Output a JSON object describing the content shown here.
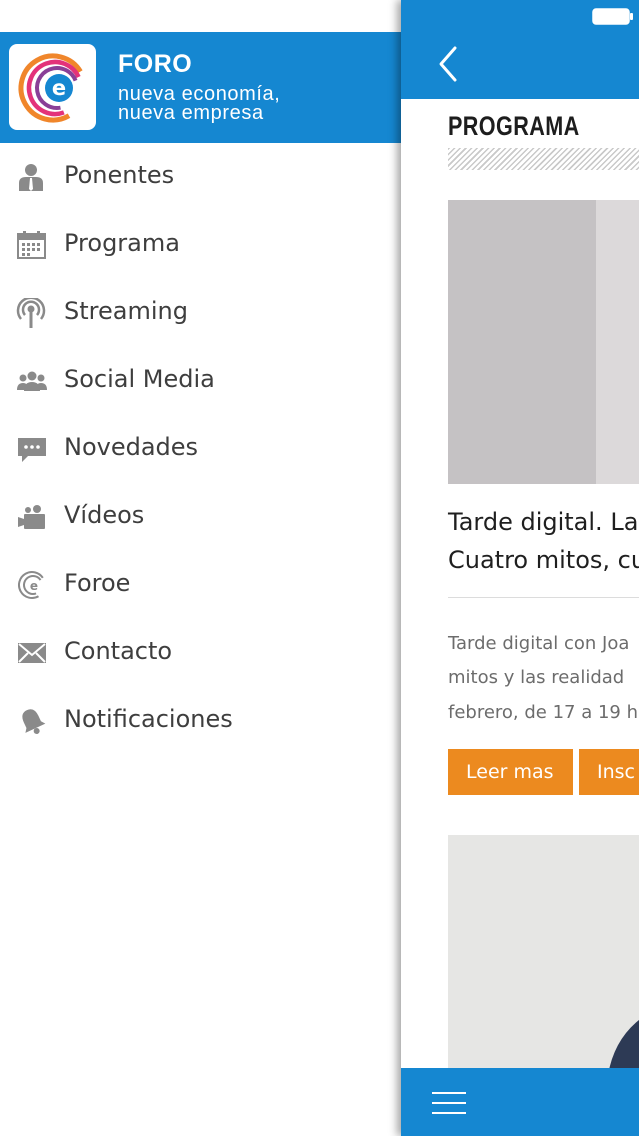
{
  "colors": {
    "accent": "#1587d1",
    "button": "#ec8a1f",
    "menu_text": "#3e3e3e",
    "icon": "#8a8a8a"
  },
  "drawer": {
    "logo_icon": "foro-e-logo-icon",
    "title": "FORO",
    "subtitle_line1": "nueva economía,",
    "subtitle_line2": "nueva empresa",
    "menu": [
      {
        "label": "Ponentes",
        "icon": "speaker-person-icon"
      },
      {
        "label": "Programa",
        "icon": "calendar-icon"
      },
      {
        "label": "Streaming",
        "icon": "broadcast-antenna-icon"
      },
      {
        "label": "Social Media",
        "icon": "group-users-icon"
      },
      {
        "label": "Novedades",
        "icon": "chat-bubble-icon"
      },
      {
        "label": "Vídeos",
        "icon": "video-camera-icon"
      },
      {
        "label": "Foroe",
        "icon": "foro-e-logo-icon"
      },
      {
        "label": "Contacto",
        "icon": "envelope-icon"
      },
      {
        "label": "Notificaciones",
        "icon": "bell-icon"
      }
    ]
  },
  "content": {
    "section_title": "PROGRAMA",
    "card1": {
      "title_line1": "Tarde digital. La",
      "title_line2": "Cuatro mitos, cu",
      "desc_line1": "Tarde digital con Joa",
      "desc_line2": "mitos y las realidad",
      "desc_line3": "febrero, de 17 a 19 h",
      "read_more": "Leer mas",
      "register": "Insc"
    }
  }
}
